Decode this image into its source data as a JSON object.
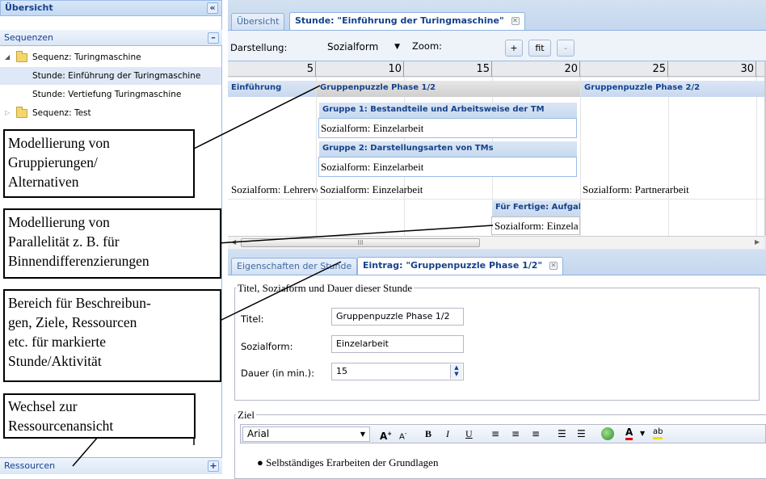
{
  "left": {
    "title": "Übersicht",
    "collapse_glyph": "«",
    "section_sequences": "Sequenzen",
    "section_collapse_glyph": "–",
    "tree": [
      {
        "label": "Sequenz: Turingmaschine",
        "level": 0,
        "expanded": true
      },
      {
        "label": "Stunde: Einführung der Turingmaschine",
        "level": 1,
        "selected": true
      },
      {
        "label": "Stunde: Vertiefung Turingmaschine",
        "level": 1
      },
      {
        "label": "Sequenz: Test",
        "level": 0,
        "expanded": false
      }
    ],
    "resources": "Ressourcen",
    "resources_glyph": "+"
  },
  "tabs": [
    {
      "label": "Übersicht"
    },
    {
      "label": "Stunde: \"Einführung der Turingmaschine\"",
      "active": true
    }
  ],
  "toolbar": {
    "darstellung_label": "Darstellung:",
    "darstellung_value": "Sozialform",
    "zoom_label": "Zoom:",
    "plus": "+",
    "fit": "fit",
    "minus": "-"
  },
  "ruler": [
    "5",
    "10",
    "15",
    "20",
    "25",
    "30"
  ],
  "timeline": {
    "einfuehrung": "Einführung",
    "gp1": "Gruppenpuzzle Phase 1/2",
    "gp2": "Gruppenpuzzle Phase 2/2",
    "gruppe1": "Gruppe 1: Bestandteile und Arbeitsweise der TM",
    "gruppe2": "Gruppe 2: Darstellungsarten von TMs",
    "sf_einzel_1": "Sozialform: Einzelarbeit",
    "sf_einzel_2": "Sozialform: Einzelarbeit",
    "sf_lehr": "Sozialform: Lehrervortrag",
    "sf_einzel_3": "Sozialform: Einzelarbeit",
    "sf_partner": "Sozialform: Partnerarbeit",
    "fertige": "Für Fertige: Aufgabe",
    "sf_ein": "Sozialform: Einzelarbeit",
    "scroll_grip": "III"
  },
  "prop_tabs": [
    {
      "label": "Eigenschaften der Stunde"
    },
    {
      "label": "Eintrag: \"Gruppenpuzzle Phase 1/2\"",
      "active": true
    }
  ],
  "props": {
    "legend": "Titel, Soziaform und Dauer dieser Stunde",
    "titel_label": "Titel:",
    "titel_value": "Gruppenpuzzle Phase 1/2",
    "sozialform_label": "Sozialform:",
    "sozialform_value": "Einzelarbeit",
    "dauer_label": "Dauer (in min.):",
    "dauer_value": "15",
    "ziel_legend": "Ziel",
    "font_value": "Arial",
    "ziel_text": "Selbständiges Erarbeiten der Grundlagen"
  },
  "annotations": {
    "a1": [
      "Modellierung von",
      "Gruppierungen/",
      "Alternativen"
    ],
    "a2": [
      "Modellierung von",
      "Parallelität z. B. für",
      "Binnendifferenzierungen"
    ],
    "a3": [
      "Bereich für Beschreibun-",
      "gen, Ziele, Ressourcen",
      "etc. für markierte",
      "Stunde/Aktivität"
    ],
    "a4": [
      "Wechsel zur",
      "Ressourcenansicht"
    ]
  }
}
